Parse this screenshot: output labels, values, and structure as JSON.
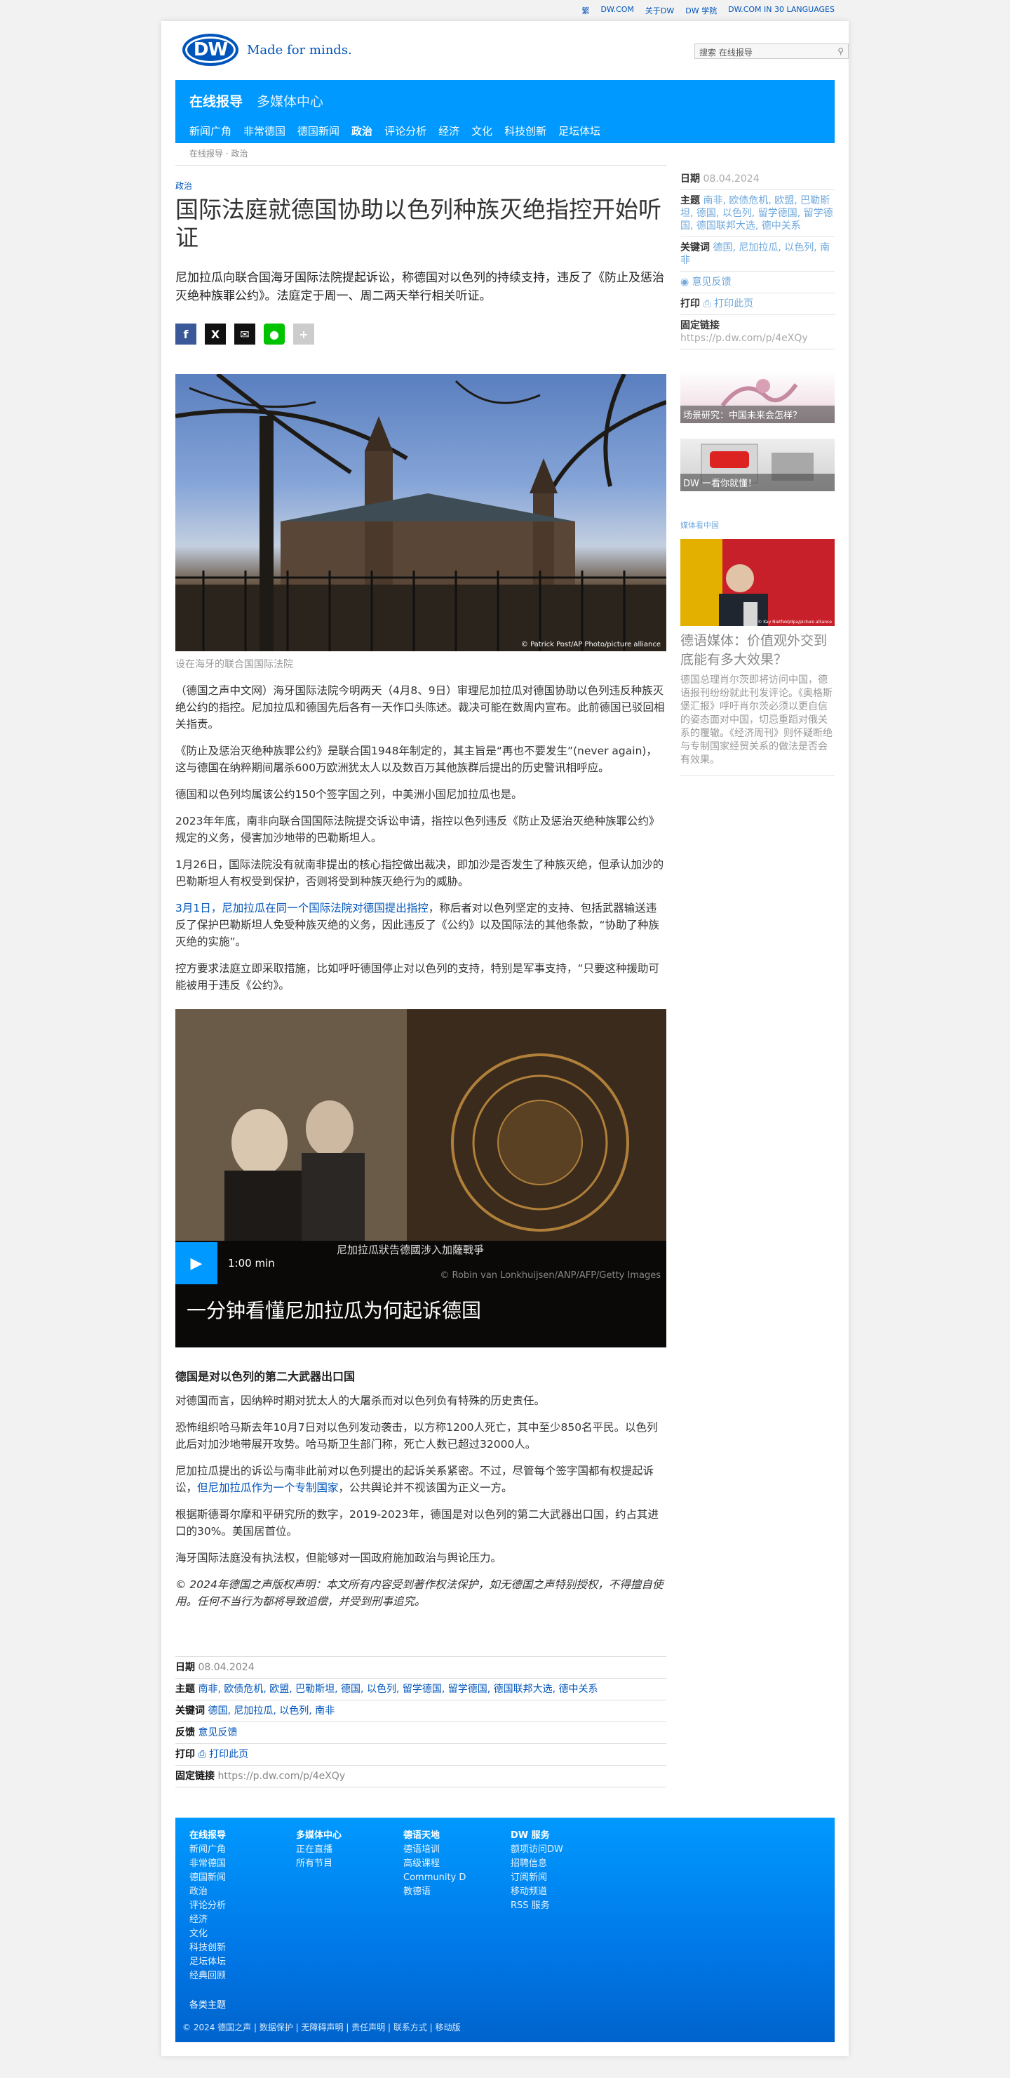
{
  "topbar": {
    "links": [
      "繁",
      "DW.COM",
      "关于DW",
      "DW 学院",
      "DW.COM IN 30 LANGUAGES"
    ]
  },
  "header": {
    "logo": "DW",
    "slogan": "Made for minds.",
    "search_placeholder": "搜索 在线报导"
  },
  "nav": {
    "main": [
      "在线报导",
      "多媒体中心"
    ],
    "sub": [
      "新闻广角",
      "非常德国",
      "德国新闻",
      "政治",
      "评论分析",
      "经济",
      "文化",
      "科技创新",
      "足坛体坛"
    ]
  },
  "breadcrumb": "在线报导 · 政治",
  "article": {
    "kicker": "政治",
    "title": "国际法庭就德国协助以色列种族灭绝指控开始听证",
    "intro": "尼加拉瓜向联合国海牙国际法院提起诉讼，称德国对以色列的持续支持，违反了《防止及惩治灭绝种族罪公约》。法庭定于周一、周二两天举行相关听证。",
    "photo_credit": "© Patrick Post/AP Photo/picture alliance",
    "caption": "设在海牙的联合国国际法院",
    "paragraphs": [
      "（德国之声中文网）海牙国际法院今明两天（4月8、9日）审理尼加拉瓜对德国协助以色列违反种族灭绝公约的指控。尼加拉瓜和德国先后各有一天作口头陈述。裁决可能在数周内宣布。此前德国已驳回相关指责。",
      "《防止及惩治灭绝种族罪公约》是联合国1948年制定的，其主旨是“再也不要发生”(never again)，这与德国在纳粹期间屠杀600万欧洲犹太人以及数百万其他族群后提出的历史警讯相呼应。",
      "德国和以色列均属该公约150个签字国之列，中美洲小国尼加拉瓜也是。",
      "2023年年底，南非向联合国国际法院提交诉讼申请，指控以色列违反《防止及惩治灭绝种族罪公约》规定的义务，侵害加沙地带的巴勒斯坦人。",
      "1月26日，国际法院没有就南非提出的核心指控做出裁决，即加沙是否发生了种族灭绝，但承认加沙的巴勒斯坦人有权受到保护，否则将受到种族灭绝行为的威胁。"
    ],
    "link_para": {
      "link": "3月1日，尼加拉瓜在同一个国际法院对德国提出指控",
      "rest": "，称后者对以色列坚定的支持、包括武器输送违反了保护巴勒斯坦人免受种族灭绝的义务，因此违反了《公约》以及国际法的其他条款，“协助了种族灭绝的实施”。"
    },
    "para_after": "控方要求法庭立即采取措施，比如呼吁德国停止对以色列的支持，特别是军事支持，“只要这种援助可能被用于违反《公约》。",
    "video": {
      "duration": "1:00 min",
      "subtitle": "尼加拉瓜狀告德國涉入加薩戰爭",
      "credit": "© Robin van Lonkhuijsen/ANP/AFP/Getty Images",
      "title": "一分钟看懂尼加拉瓜为何起诉德国",
      "seal_text": "COUR INTERNATIONALE DE JUSTICE · INTERNATIONAL COURT OF JUSTICE"
    },
    "subheading": "德国是对以色列的第二大武器出口国",
    "paragraphs2": [
      "对德国而言，因纳粹时期对犹太人的大屠杀而对以色列负有特殊的历史责任。",
      "恐怖组织哈马斯去年10月7日对以色列发动袭击，以方称1200人死亡，其中至少850名平民。以色列此后对加沙地带展开攻势。哈马斯卫生部门称，死亡人数已超过32000人。"
    ],
    "para_link2": {
      "pre": "尼加拉瓜提出的诉讼与南非此前对以色列提出的起诉关系紧密。不过，尽管每个签字国都有权提起诉讼，",
      "link": "但尼加拉瓜作为一个专制国家",
      "post": "，公共舆论并不视该国为正义一方。"
    },
    "paragraphs3": [
      "根据斯德哥尔摩和平研究所的数字，2019-2023年，德国是对以色列的第二大武器出口国，约占其进口的30%。美国居首位。",
      "海牙国际法庭没有执法权，但能够对一国政府施加政治与舆论压力。"
    ],
    "copyright": "© 2024年德国之声版权声明：本文所有内容受到著作权法保护，如无德国之声特别授权，不得擅自使用。任何不当行为都将导致追偿，并受到刑事追究。"
  },
  "meta": {
    "date_label": "日期",
    "date": "08.04.2024",
    "topics_label": "主题",
    "topics": "南非, 欧债危机, 欧盟, 巴勒斯坦, 德国, 以色列, 留学德国, 留学德国, 德国联邦大选, 德中关系",
    "keywords_label": "关键词",
    "keywords": "德国, 尼加拉瓜, 以色列, 南非",
    "feedback_label": "反馈",
    "feedback": "意见反馈",
    "print_label": "打印",
    "print": "打印此页",
    "permalink_label": "固定链接",
    "permalink": "https://p.dw.com/p/4eXQy"
  },
  "sidebar": {
    "date_label": "日期",
    "date": "08.04.2024",
    "topics_label": "主题",
    "topics": "南非, 欧债危机, 欧盟, 巴勒斯坦, 德国, 以色列, 留学德国, 留学德国, 德国联邦大选, 德中关系",
    "keywords_label": "关键词",
    "keywords": "德国, 尼加拉瓜, 以色列, 南非",
    "feedback": "意见反馈",
    "print_label": "打印",
    "print": "打印此页",
    "permalink_label": "固定链接",
    "permalink": "https://p.dw.com/p/4eXQy",
    "teaser1": "场景研究：中国未来会怎样？",
    "teaser2": "DW 一看你就懂！",
    "section": "媒体看中国",
    "news_credit": "© Kay Nietfeld/dpa/picture alliance",
    "news_title": "德语媒体：价值观外交到底能有多大效果？",
    "news_text": "德国总理肖尔茨即将访问中国，德语报刊纷纷就此刊发评论。《奥格斯堡汇报》呼吁肖尔茨必须以更自信的姿态面对中国，切忌重蹈对俄关系的覆辙。《经济周刊》则怀疑断绝与专制国家经贸关系的做法是否会有效果。"
  },
  "footer": {
    "col1": {
      "head": "在线报导",
      "items": [
        "新闻广角",
        "非常德国",
        "德国新闻",
        "政治",
        "评论分析",
        "经济",
        "文化",
        "科技创新",
        "足坛体坛",
        "经典回顾"
      ]
    },
    "col2": {
      "head": "多媒体中心",
      "items": [
        "正在直播",
        "所有节目"
      ]
    },
    "col3": {
      "head": "德语天地",
      "items": [
        "德语培训",
        "高级课程",
        "Community D",
        "教德语"
      ]
    },
    "col4": {
      "head": "DW 服务",
      "items": [
        "额项访问DW",
        "招聘信息",
        "订阅新闻",
        "移动频道",
        "RSS 服务"
      ]
    },
    "themes": "各类主题",
    "legal": "© 2024 德国之声 | 数据保护 | 无障碍声明 | 责任声明 | 联系方式 | 移动版"
  },
  "colors": {
    "brand": "#0099ff",
    "link": "#0055bb"
  }
}
